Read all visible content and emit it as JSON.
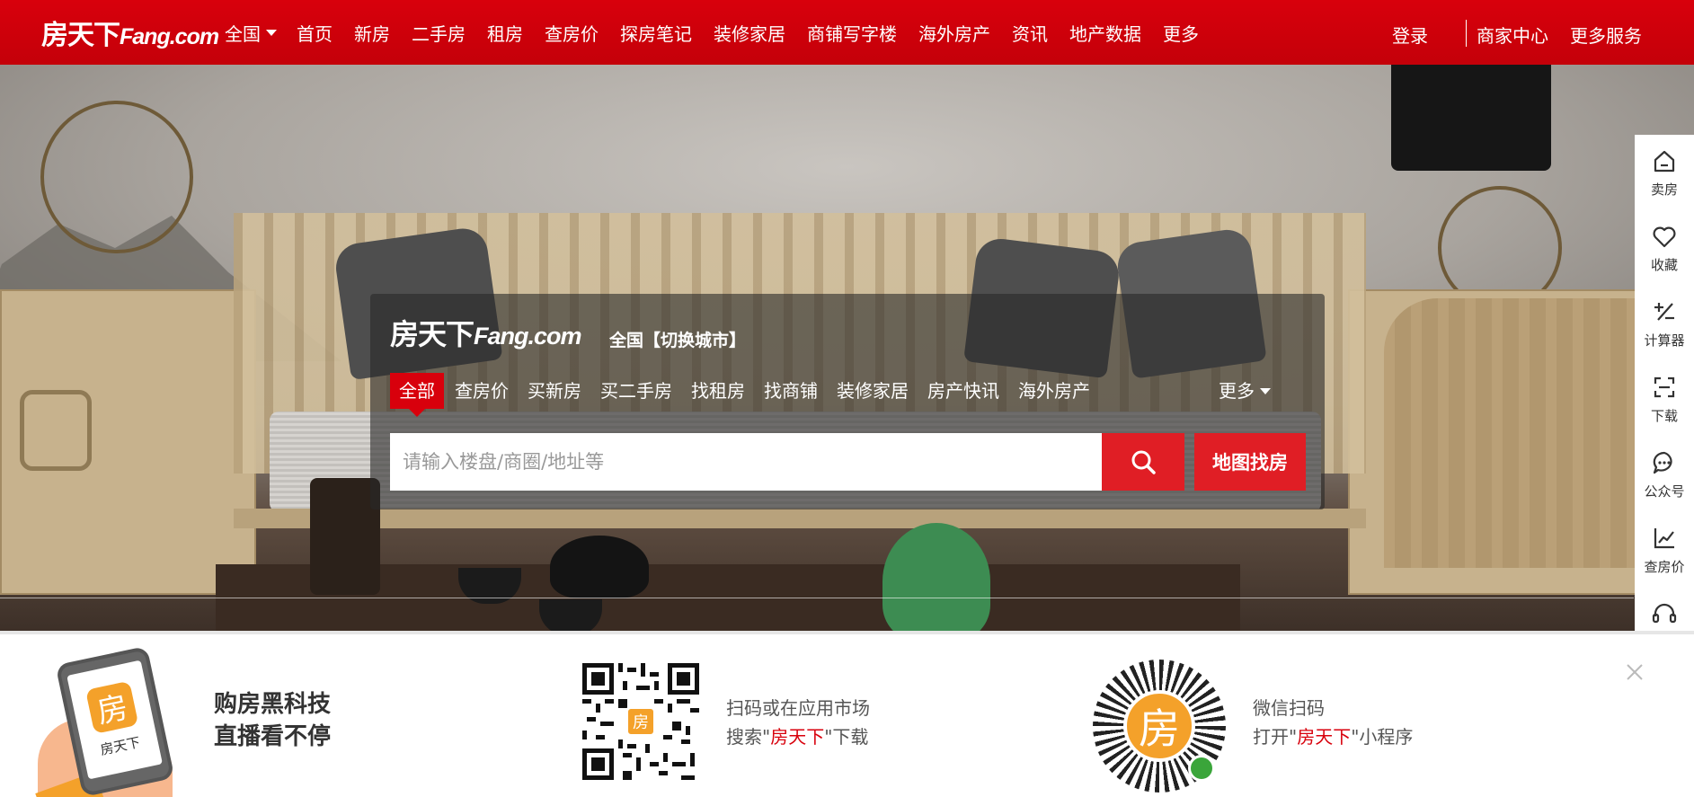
{
  "header": {
    "logo_cn": "房天下",
    "logo_en": "Fang.com",
    "city": "全国",
    "nav": [
      "首页",
      "新房",
      "二手房",
      "租房",
      "查房价",
      "探房笔记",
      "装修家居",
      "商铺写字楼",
      "海外房产",
      "资讯",
      "地产数据",
      "更多"
    ],
    "login": "登录",
    "merchant_center": "商家中心",
    "more_services": "更多服务"
  },
  "search": {
    "logo_cn": "房天下",
    "logo_en": "Fang.com",
    "switch_city": "全国【切换城市】",
    "tabs": [
      "全部",
      "查房价",
      "买新房",
      "买二手房",
      "找租房",
      "找商铺",
      "装修家居",
      "房产快讯",
      "海外房产"
    ],
    "active_tab": "全部",
    "more": "更多",
    "placeholder": "请输入楼盘/商圈/地址等",
    "map_button": "地图找房"
  },
  "sidebar": [
    {
      "label": "卖房",
      "icon": "home-icon"
    },
    {
      "label": "收藏",
      "icon": "heart-icon"
    },
    {
      "label": "计算器",
      "icon": "calculator-icon"
    },
    {
      "label": "下载",
      "icon": "scan-icon"
    },
    {
      "label": "公众号",
      "icon": "chat-icon"
    },
    {
      "label": "查房价",
      "icon": "chart-icon"
    },
    {
      "label": "客服",
      "icon": "headset-icon"
    }
  ],
  "banner": {
    "phone_app_char": "房",
    "phone_caption": "房天下",
    "slogan_line1": "购房黑科技",
    "slogan_line2": "直播看不停",
    "qr_center_char": "房",
    "qr_line1": "扫码或在应用市场",
    "qr_line2_a": "搜索\"",
    "qr_line2_hl": "房天下",
    "qr_line2_b": "\"下载",
    "mini_char": "房",
    "mini_line1": "微信扫码",
    "mini_line2_a": "打开\"",
    "mini_line2_hl": "房天下",
    "mini_line2_b": "\"小程序"
  },
  "colors": {
    "brand_red": "#d8000c",
    "button_red": "#e01e25",
    "app_orange": "#f4a12a"
  }
}
